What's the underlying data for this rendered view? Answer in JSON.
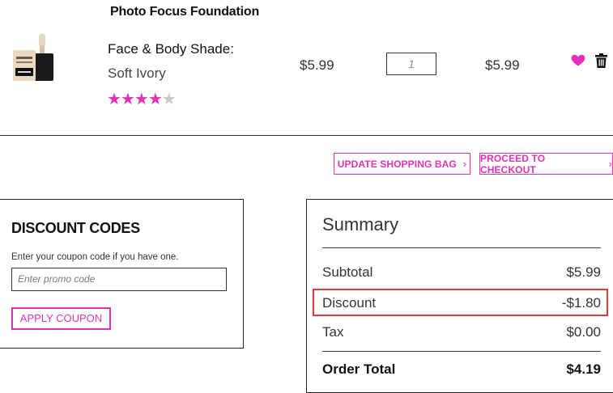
{
  "product": {
    "name": "Photo Focus Foundation",
    "variant_label": "Face & Body Shade:",
    "variant_value": "Soft Ivory",
    "rating": 4,
    "rating_max": 5,
    "price": "$5.99",
    "quantity": "1",
    "line_total": "$5.99",
    "icons": [
      "product-thumbnail",
      "heart-icon",
      "trash-icon"
    ]
  },
  "bag_actions": {
    "update_label": "UPDATE SHOPPING BAG",
    "checkout_label": "PROCEED TO CHECKOUT",
    "chevron": "›"
  },
  "discount": {
    "title": "DISCOUNT CODES",
    "help": "Enter your coupon code if you have one.",
    "placeholder": "Enter promo code",
    "apply_label": "APPLY COUPON"
  },
  "summary": {
    "title": "Summary",
    "subtotal_label": "Subtotal",
    "subtotal_value": "$5.99",
    "discount_label": "Discount",
    "discount_value": "-$1.80",
    "tax_label": "Tax",
    "tax_value": "$0.00",
    "total_label": "Order Total",
    "total_value": "$4.19"
  },
  "colors": {
    "accent": "#e231b6",
    "highlight": "#e03a3a"
  }
}
